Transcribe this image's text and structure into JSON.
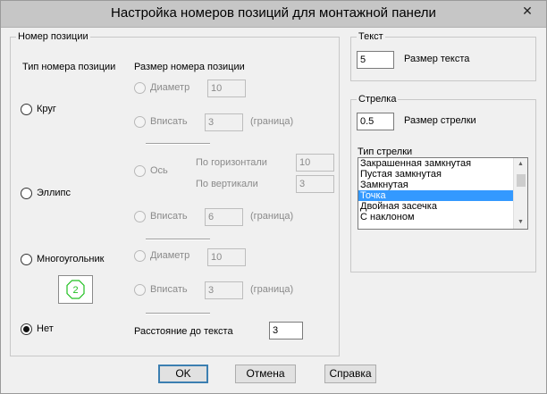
{
  "window": {
    "title": "Настройка номеров позиций для монтажной панели",
    "close_glyph": "✕"
  },
  "position_group": {
    "label": "Номер позиции",
    "type_heading": "Тип номера позиции",
    "size_heading": "Размер номера позиции",
    "type_options": {
      "circle": "Круг",
      "ellipse": "Эллипс",
      "polygon": "Многоугольник",
      "none": "Нет"
    },
    "selected_type": "none",
    "circle_size": {
      "diameter_label": "Диаметр",
      "diameter_value": "10",
      "fit_label": "Вписать",
      "fit_value": "3",
      "fit_suffix": "(граница)"
    },
    "ellipse_size": {
      "axis_label": "Ось",
      "horizontal_label": "По горизонтали",
      "horizontal_value": "10",
      "vertical_label": "По вертикали",
      "vertical_value": "3",
      "fit_label": "Вписать",
      "fit_value": "6",
      "fit_suffix": "(граница)"
    },
    "polygon_size": {
      "diameter_label": "Диаметр",
      "diameter_value": "10",
      "fit_label": "Вписать",
      "fit_value": "3",
      "fit_suffix": "(граница)",
      "preview_number": "2",
      "preview_color": "#21c021"
    },
    "distance_label": "Расстояние до текста",
    "distance_value": "3"
  },
  "text_group": {
    "label": "Текст",
    "size_value": "5",
    "size_label": "Размер текста"
  },
  "arrow_group": {
    "label": "Стрелка",
    "size_value": "0.5",
    "size_label": "Размер стрелки",
    "type_label": "Тип стрелки",
    "types": [
      "Закрашенная замкнутая",
      "Пустая замкнутая",
      "Замкнутая",
      "Точка",
      "Двойная засечка",
      "С наклоном"
    ],
    "selected_index": 3,
    "selection_color": "#3399ff"
  },
  "buttons": {
    "ok": "OK",
    "cancel": "Отмена",
    "help": "Справка"
  }
}
